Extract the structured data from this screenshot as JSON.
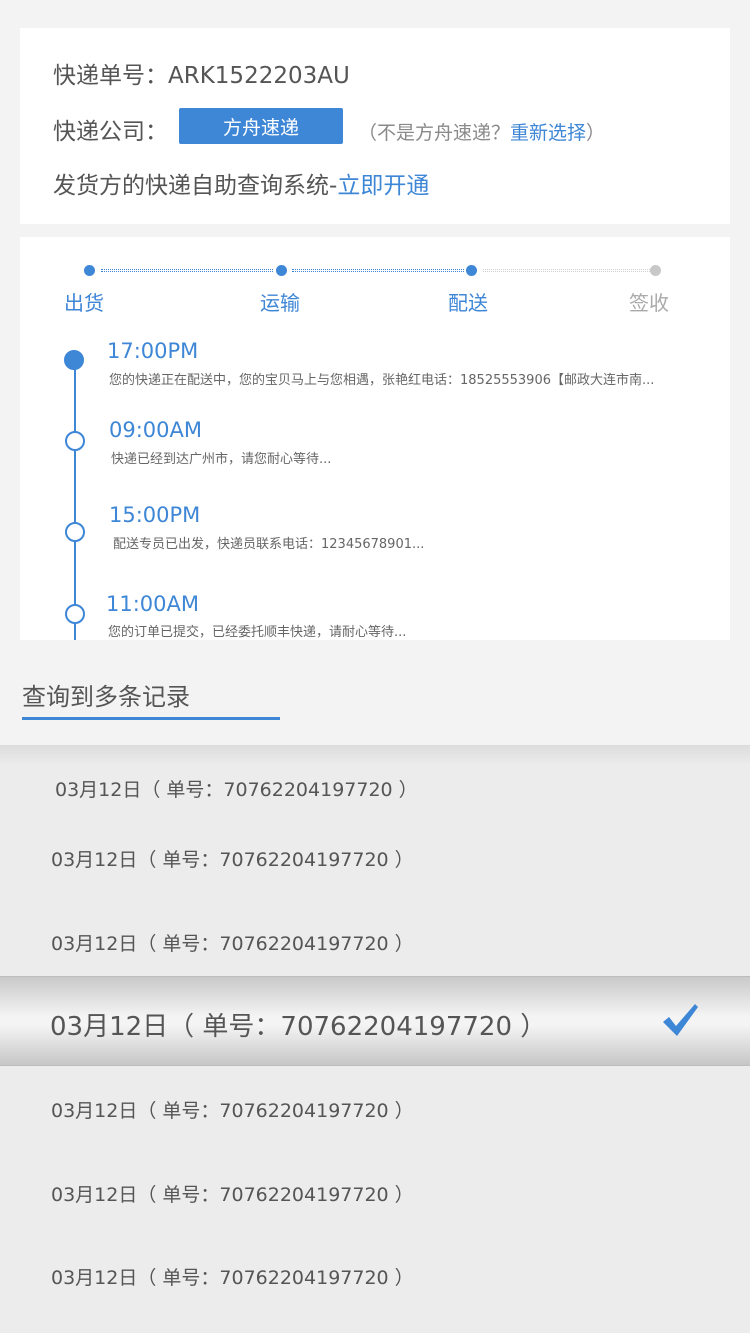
{
  "header": {
    "tracking_label": "快递单号：",
    "tracking_number": "ARK1522203AU",
    "company_label": "快递公司：",
    "company_name": "方舟速递",
    "not_company_prefix": "（不是方舟速递？",
    "reselect_link": "重新选择",
    "not_company_suffix": "）",
    "selfservice_text": "发货方的快递自助查询系统-",
    "open_now_link": "立即开通"
  },
  "progress": {
    "steps": [
      {
        "label": "出货",
        "done": true
      },
      {
        "label": "运输",
        "done": true
      },
      {
        "label": "配送",
        "done": true
      },
      {
        "label": "签收",
        "done": false
      }
    ]
  },
  "timeline": [
    {
      "time": "17:00PM",
      "text": "您的快递正在配送中，您的宝贝马上与您相遇，张艳红电话：18525553906【邮政大连市南..."
    },
    {
      "time": "09:00AM",
      "text": "快递已经到达广州市，请您耐心等待..."
    },
    {
      "time": "15:00PM",
      "text": "配送专员已出发，快递员联系电话：12345678901..."
    },
    {
      "time": "11:00AM",
      "text": "您的订单已提交，已经委托顺丰快递，请耐心等待..."
    }
  ],
  "records": {
    "title": "查询到多条记录",
    "items": [
      "03月12日（ 单号：70762204197720 ）",
      "03月12日（ 单号：70762204197720 ）",
      "03月12日（ 单号：70762204197720 ）",
      "03月12日（ 单号：70762204197720 ）",
      "03月12日（ 单号：70762204197720 ）",
      "03月12日（ 单号：70762204197720 ）",
      "03月12日（ 单号：70762204197720 ）"
    ],
    "selected_index": 3
  },
  "colors": {
    "accent": "#3e86d6",
    "inactive": "#c8c8c8"
  }
}
